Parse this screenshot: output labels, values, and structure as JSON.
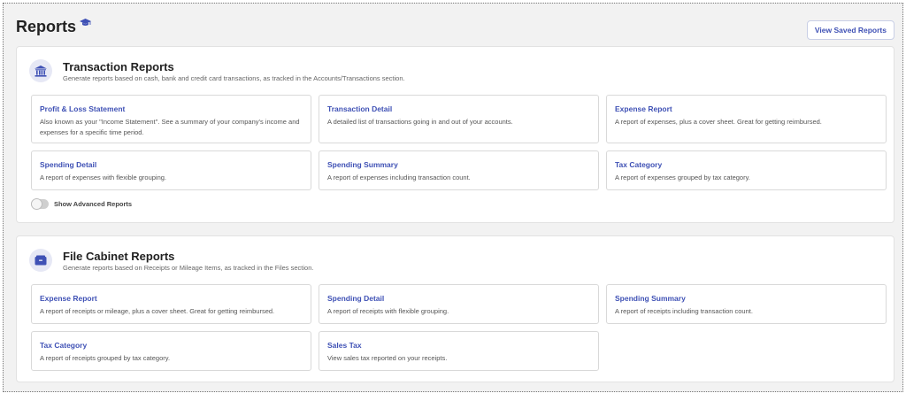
{
  "header": {
    "title": "Reports",
    "view_saved_label": "View Saved Reports"
  },
  "transaction": {
    "title": "Transaction Reports",
    "subtitle": "Generate reports based on cash, bank and credit card transactions, as tracked in the Accounts/Transactions section.",
    "icon": "bank-icon",
    "cards": [
      {
        "title": "Profit & Loss Statement",
        "desc": "Also known as your \"Income Statement\". See a summary of your company's income and expenses for a specific time period."
      },
      {
        "title": "Transaction Detail",
        "desc": "A detailed list of transactions going in and out of your accounts."
      },
      {
        "title": "Expense Report",
        "desc": "A report of expenses, plus a cover sheet. Great for getting reimbursed."
      },
      {
        "title": "Spending Detail",
        "desc": "A report of expenses with flexible grouping."
      },
      {
        "title": "Spending Summary",
        "desc": "A report of expenses including transaction count."
      },
      {
        "title": "Tax Category",
        "desc": "A report of expenses grouped by tax category."
      }
    ],
    "toggle_label": "Show Advanced Reports",
    "toggle_on": false
  },
  "file_cabinet": {
    "title": "File Cabinet Reports",
    "subtitle": "Generate reports based on Receipts or Mileage Items, as tracked in the Files section.",
    "icon": "file-cabinet-icon",
    "cards": [
      {
        "title": "Expense Report",
        "desc": "A report of receipts or mileage, plus a cover sheet. Great for getting reimbursed."
      },
      {
        "title": "Spending Detail",
        "desc": "A report of receipts with flexible grouping."
      },
      {
        "title": "Spending Summary",
        "desc": "A report of receipts including transaction count."
      },
      {
        "title": "Tax Category",
        "desc": "A report of receipts grouped by tax category."
      },
      {
        "title": "Sales Tax",
        "desc": "View sales tax reported on your receipts."
      }
    ]
  },
  "colors": {
    "accent": "#3f51b5",
    "icon_bg": "#e6e8f5"
  }
}
